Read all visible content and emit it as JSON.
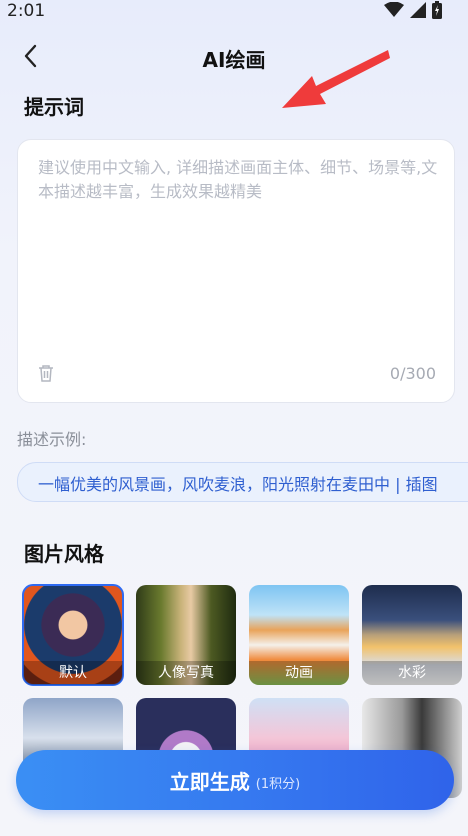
{
  "status": {
    "time": "2:01",
    "icons": [
      "wifi-icon",
      "signal-icon",
      "battery-icon"
    ]
  },
  "header": {
    "title": "AI绘画",
    "back_icon": "chevron-left-icon"
  },
  "prompt": {
    "section_title": "提示词",
    "placeholder": "建议使用中文输入, 详细描述画面主体、细节、场景等,文本描述越丰富，生成效果越精美",
    "value": "",
    "counter": "0/300",
    "clear_icon": "trash-icon"
  },
  "examples": {
    "label": "描述示例:",
    "items": [
      "一幅优美的风景画，风吹麦浪，阳光照射在麦田中 | 插图"
    ]
  },
  "styles": {
    "section_title": "图片风格",
    "items": [
      {
        "label": "默认",
        "selected": true
      },
      {
        "label": "人像写真",
        "selected": false
      },
      {
        "label": "动画",
        "selected": false
      },
      {
        "label": "水彩",
        "selected": false
      },
      {
        "label": "",
        "selected": false
      },
      {
        "label": "",
        "selected": false
      },
      {
        "label": "",
        "selected": false
      },
      {
        "label": "",
        "selected": false
      }
    ]
  },
  "generate": {
    "label": "立即生成",
    "cost": "(1积分)"
  },
  "colors": {
    "accent": "#3576ef",
    "chip_bg": "#eaf1fd",
    "chip_text": "#2f5fd0",
    "arrow": "#ef3b3b"
  }
}
